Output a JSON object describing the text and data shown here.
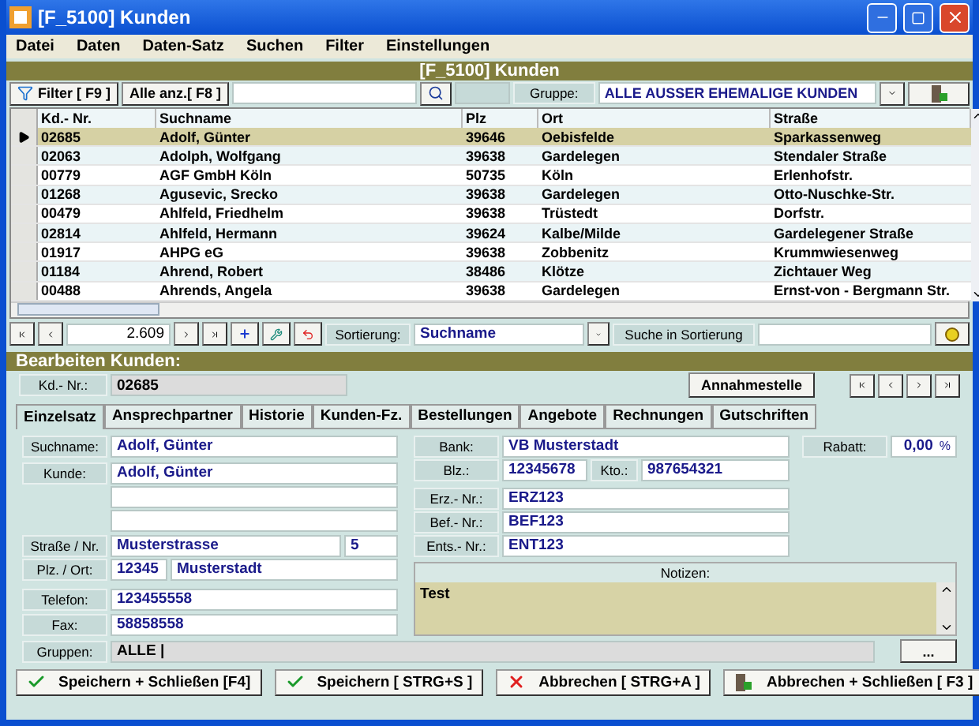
{
  "window": {
    "title": "[F_5100] Kunden"
  },
  "menu": [
    "Datei",
    "Daten",
    "Daten-Satz",
    "Suchen",
    "Filter",
    "Einstellungen"
  ],
  "header_band": "[F_5100] Kunden",
  "toolbar": {
    "filter_button": "Filter [ F9 ]",
    "show_all_button": "Alle anz.[ F8 ]",
    "group_label": "Gruppe:",
    "group_value": "ALLE AUSSER EHEMALIGE KUNDEN"
  },
  "table": {
    "columns": [
      "Kd.- Nr.",
      "Suchname",
      "Plz",
      "Ort",
      "Straße"
    ],
    "rows": [
      {
        "cells": [
          "02685",
          "Adolf, Günter",
          "39646",
          "Oebisfelde",
          "Sparkassenweg"
        ],
        "selected": true
      },
      {
        "cells": [
          "02063",
          "Adolph, Wolfgang",
          "39638",
          "Gardelegen",
          "Stendaler Straße"
        ],
        "selected": false
      },
      {
        "cells": [
          "00779",
          "AGF GmbH Köln",
          "50735",
          "Köln",
          "Erlenhofstr."
        ],
        "selected": false
      },
      {
        "cells": [
          "01268",
          "Agusevic, Srecko",
          "39638",
          "Gardelegen",
          "Otto-Nuschke-Str."
        ],
        "selected": false
      },
      {
        "cells": [
          "00479",
          "Ahlfeld, Friedhelm",
          "39638",
          "Trüstedt",
          "Dorfstr."
        ],
        "selected": false
      },
      {
        "cells": [
          "02814",
          "Ahlfeld, Hermann",
          "39624",
          "Kalbe/Milde",
          "Gardelegener Straße"
        ],
        "selected": false
      },
      {
        "cells": [
          "01917",
          "AHPG eG",
          "39638",
          "Zobbenitz",
          "Krummwiesenweg"
        ],
        "selected": false
      },
      {
        "cells": [
          "01184",
          "Ahrend, Robert",
          "38486",
          "Klötze",
          "Zichtauer Weg"
        ],
        "selected": false
      },
      {
        "cells": [
          "00488",
          "Ahrends, Angela",
          "39638",
          "Gardelegen",
          "Ernst-von - Bergmann Str."
        ],
        "selected": false
      }
    ]
  },
  "navigator": {
    "record_count": "2.609",
    "sort_label": "Sortierung:",
    "sort_value": "Suchname",
    "search_label": "Suche in Sortierung"
  },
  "edit": {
    "title": "Bearbeiten Kunden:",
    "id_label": "Kd.- Nr.:",
    "id_value": "02685",
    "annahme_button": "Annahmestelle"
  },
  "tabs": [
    {
      "label": "Einzelsatz",
      "selected": true
    },
    {
      "label": "Ansprechpartner",
      "selected": false
    },
    {
      "label": "Historie",
      "selected": false
    },
    {
      "label": "Kunden-Fz.",
      "selected": false
    },
    {
      "label": "Bestellungen",
      "selected": false
    },
    {
      "label": "Angebote",
      "selected": false
    },
    {
      "label": "Rechnungen",
      "selected": false
    },
    {
      "label": "Gutschriften",
      "selected": false
    }
  ],
  "form": {
    "suchname": {
      "label": "Suchname:",
      "value": "Adolf, Günter"
    },
    "kunde": {
      "label": "Kunde:",
      "value": "Adolf, Günter"
    },
    "strasse": {
      "label": "Straße / Nr.",
      "street": "Musterstrasse",
      "number": "5"
    },
    "ort": {
      "label": "Plz. / Ort:",
      "zip": "12345",
      "city": "Musterstadt"
    },
    "telefon": {
      "label": "Telefon:",
      "value": "123455558"
    },
    "fax": {
      "label": "Fax:",
      "value": "58858558"
    },
    "bank": {
      "label": "Bank:",
      "value": "VB Musterstadt"
    },
    "blz": {
      "label": "Blz.:",
      "value": "12345678",
      "kto_label": "Kto.:",
      "kto_value": "987654321"
    },
    "numbers": [
      {
        "label": "Erz.- Nr.:",
        "value": "ERZ123"
      },
      {
        "label": "Bef.- Nr.:",
        "value": "BEF123"
      },
      {
        "label": "Ents.- Nr.:",
        "value": "ENT123"
      }
    ],
    "rabatt": {
      "label": "Rabatt:",
      "value": "0,00",
      "unit": "%"
    },
    "notes": {
      "label": "Notizen:",
      "value": "Test"
    },
    "gruppen": {
      "label": "Gruppen:",
      "value": "ALLE |",
      "button": "..."
    }
  },
  "buttons": [
    {
      "label": "Speichern + Schließen [F4]",
      "kind": "save"
    },
    {
      "label": "Speichern [ STRG+S ]",
      "kind": "save"
    },
    {
      "label": "Abbrechen [ STRG+A ]",
      "kind": "cancel"
    },
    {
      "label": "Abbrechen + Schließen [ F3 ]",
      "kind": "exit"
    }
  ]
}
